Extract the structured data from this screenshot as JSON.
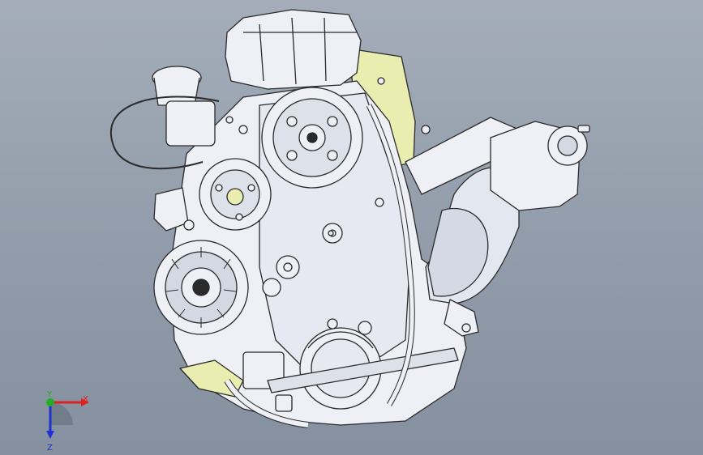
{
  "viewport": {
    "background_top": "#a4adb9",
    "background_bottom": "#8590a0"
  },
  "model": {
    "line_color": "#2a2a2a",
    "body_fill": "#eef0f6",
    "shade_fill": "#c9cfdb",
    "accent_fill": "#e9edb0"
  },
  "triad": {
    "x_label": "X",
    "y_label": "Y",
    "z_label": "Z",
    "x_color": "#e02020",
    "y_color": "#20b020",
    "z_color": "#2030d0"
  }
}
